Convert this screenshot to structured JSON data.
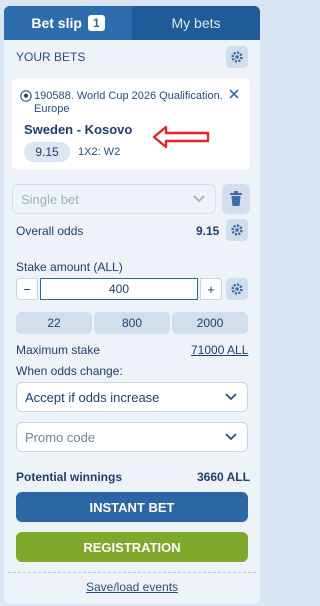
{
  "tabs": {
    "bet_slip": "Bet slip",
    "bet_slip_count": "1",
    "my_bets": "My bets"
  },
  "your_bets": "YOUR BETS",
  "event": {
    "meta": "190588. World Cup 2026 Qualification. Europe",
    "teams": "Sweden - Kosovo",
    "odds": "9.15",
    "market": "1X2: W2"
  },
  "bet_type": {
    "selected": "Single bet"
  },
  "overall_odds": {
    "label": "Overall odds",
    "value": "9.15"
  },
  "stake": {
    "label": "Stake amount (ALL)",
    "minus": "−",
    "plus": "+",
    "value": "400",
    "quick": [
      "22",
      "800",
      "2000"
    ]
  },
  "max_stake": {
    "label": "Maximum stake",
    "value": "71000 ALL"
  },
  "odds_change": {
    "label": "When odds change:",
    "selected": "Accept if odds increase"
  },
  "promo": {
    "placeholder": "Promo code"
  },
  "potential": {
    "label": "Potential winnings",
    "value": "3660 ALL"
  },
  "buttons": {
    "instant_bet": "INSTANT BET",
    "registration": "REGISTRATION"
  },
  "footer": {
    "save_load": "Save/load events"
  },
  "colors": {
    "primary": "#2c66a4",
    "green": "#7ea92a",
    "annotation_red": "#e3262b"
  }
}
